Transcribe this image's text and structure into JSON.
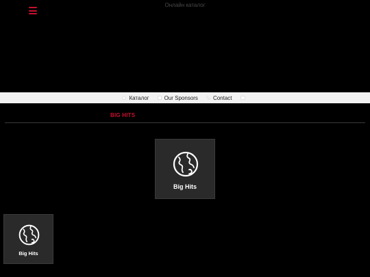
{
  "header": {
    "menu_icon": "hamburger-menu-icon",
    "site_title": "Онлайн каталог"
  },
  "nav": {
    "items": [
      {
        "label": "Каталог",
        "icon": "home-icon"
      },
      {
        "label": "Our Sponsors",
        "icon": "sponsor-icon"
      },
      {
        "label": "Contact",
        "icon": "phone-icon"
      },
      {
        "label": "",
        "icon": "extra-icon"
      }
    ]
  },
  "section": {
    "title": "BIG HITS"
  },
  "tiles": [
    {
      "label": "Big Hits",
      "icon": "globe-icon"
    },
    {
      "label": "Big Hits",
      "icon": "globe-icon"
    }
  ],
  "colors": {
    "background": "#000000",
    "accent": "#c8102e",
    "navbar": "#f2f2f2",
    "tile": "#2a2a2a"
  }
}
